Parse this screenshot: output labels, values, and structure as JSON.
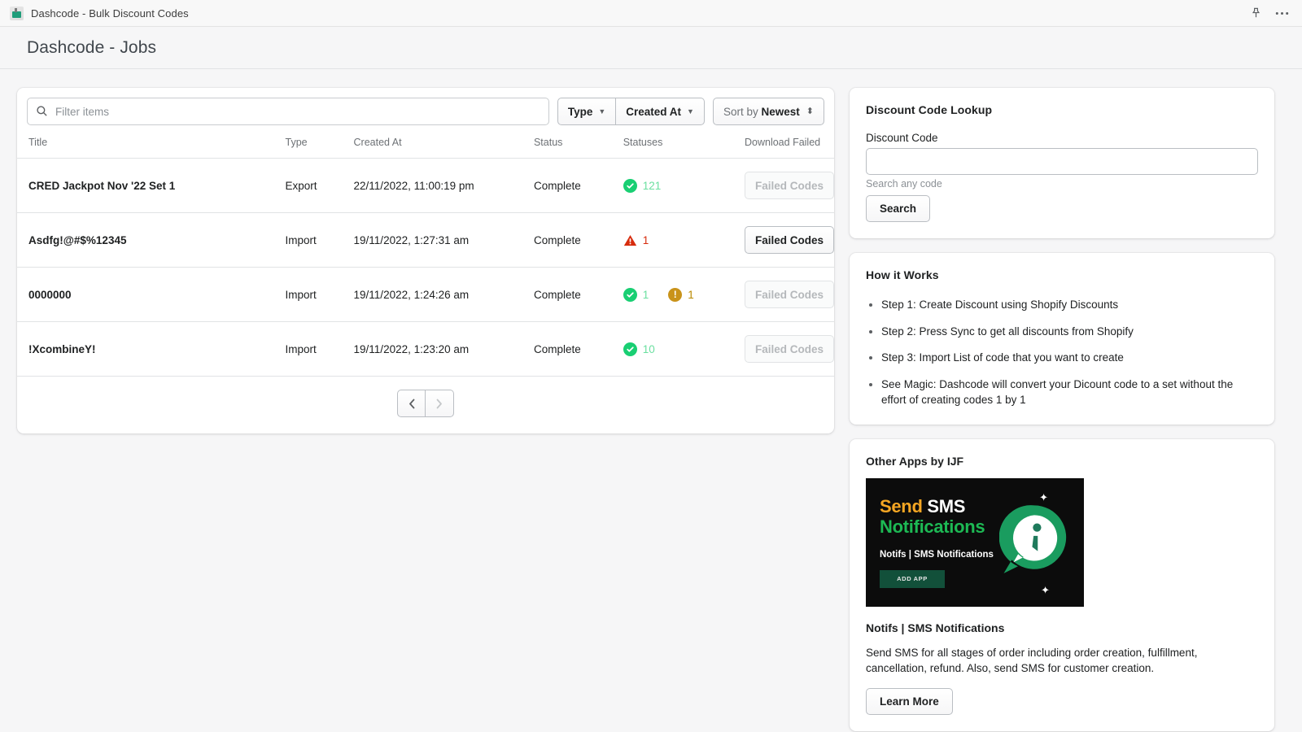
{
  "titlebar": {
    "title": "Dashcode - Bulk Discount Codes",
    "pin_icon": "pin-icon",
    "more_icon": "ellipsis-icon"
  },
  "header": {
    "title": "Dashcode - Jobs"
  },
  "filters": {
    "search_placeholder": "Filter items",
    "search_value": "",
    "type_label": "Type",
    "created_at_label": "Created At",
    "sort_prefix": "Sort by ",
    "sort_value": "Newest"
  },
  "table": {
    "columns": [
      "Title",
      "Type",
      "Created At",
      "Status",
      "Statuses",
      "Download Failed"
    ],
    "rows": [
      {
        "title": "CRED Jackpot Nov '22 Set 1",
        "type": "Export",
        "created_at": "22/11/2022, 11:00:19 pm",
        "status": "Complete",
        "statuses": [
          {
            "kind": "success",
            "count": "121"
          }
        ],
        "failed_label": "Failed Codes",
        "failed_enabled": false
      },
      {
        "title": "Asdfg!@#$%12345",
        "type": "Import",
        "created_at": "19/11/2022, 1:27:31 am",
        "status": "Complete",
        "statuses": [
          {
            "kind": "critical",
            "count": "1"
          }
        ],
        "failed_label": "Failed Codes",
        "failed_enabled": true
      },
      {
        "title": "0000000",
        "type": "Import",
        "created_at": "19/11/2022, 1:24:26 am",
        "status": "Complete",
        "statuses": [
          {
            "kind": "success",
            "count": "1"
          },
          {
            "kind": "warning",
            "count": "1"
          }
        ],
        "failed_label": "Failed Codes",
        "failed_enabled": false
      },
      {
        "title": "!XcombineY!",
        "type": "Import",
        "created_at": "19/11/2022, 1:23:20 am",
        "status": "Complete",
        "statuses": [
          {
            "kind": "success",
            "count": "10"
          }
        ],
        "failed_label": "Failed Codes",
        "failed_enabled": false
      }
    ],
    "pagination": {
      "prev_icon": "chevron-left-icon",
      "next_icon": "chevron-right-icon"
    }
  },
  "lookup": {
    "heading": "Discount Code Lookup",
    "field_label": "Discount Code",
    "field_value": "",
    "help_text": "Search any code",
    "search_button": "Search"
  },
  "how_it_works": {
    "heading": "How it Works",
    "steps": [
      "Step 1: Create Discount using Shopify Discounts",
      "Step 2: Press Sync to get all discounts from Shopify",
      "Step 3: Import List of code that you want to create",
      "See Magic: Dashcode will convert your Dicount code to a set without the effort of creating codes 1 by 1"
    ]
  },
  "other_apps": {
    "heading": "Other Apps by IJF",
    "banner": {
      "line1_orange": "Send",
      "line1_white": " SMS",
      "line2": "Notifications",
      "subtitle": "Notifs | SMS Notifications",
      "cta": "ADD APP"
    },
    "app_title": "Notifs | SMS Notifications",
    "app_desc": "Send SMS for all stages of order including order creation, fulfillment, cancellation, refund. Also, send SMS for customer creation.",
    "learn_more": "Learn More"
  },
  "colors": {
    "success": "#19cf73",
    "success_text": "#6bdfa0",
    "critical": "#d72c0d",
    "warning": "#c9931a",
    "page_bg": "#f6f6f7",
    "card_bg": "#ffffff",
    "border": "#e1e3e5"
  }
}
